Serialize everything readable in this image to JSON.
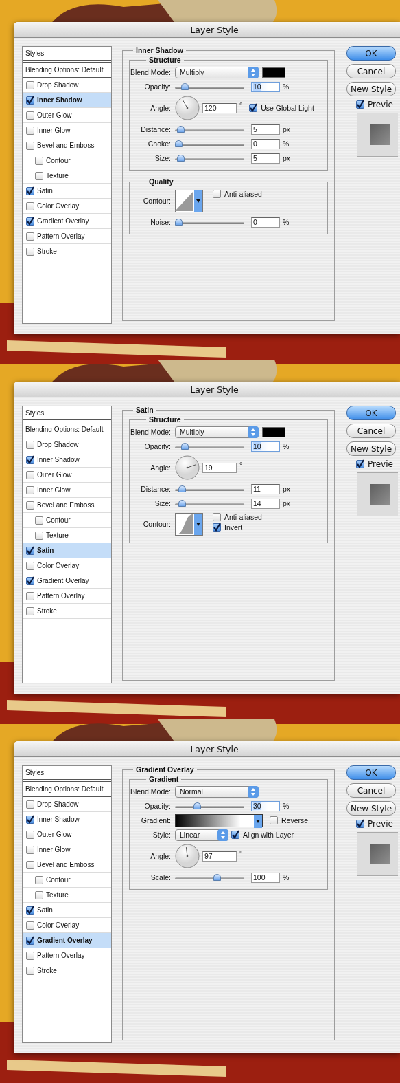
{
  "dialogs": [
    {
      "title": "Layer Style",
      "styles": {
        "header": "Styles",
        "blending": "Blending Options: Default",
        "items": [
          {
            "label": "Drop Shadow",
            "checked": false,
            "selected": false
          },
          {
            "label": "Inner Shadow",
            "checked": true,
            "selected": true
          },
          {
            "label": "Outer Glow",
            "checked": false,
            "selected": false
          },
          {
            "label": "Inner Glow",
            "checked": false,
            "selected": false
          },
          {
            "label": "Bevel and Emboss",
            "checked": false,
            "selected": false,
            "children": [
              {
                "label": "Contour",
                "checked": false,
                "selected": false
              },
              {
                "label": "Texture",
                "checked": false,
                "selected": false
              }
            ]
          },
          {
            "label": "Satin",
            "checked": true,
            "selected": false
          },
          {
            "label": "Color Overlay",
            "checked": false,
            "selected": false
          },
          {
            "label": "Gradient Overlay",
            "checked": true,
            "selected": false
          },
          {
            "label": "Pattern Overlay",
            "checked": false,
            "selected": false
          },
          {
            "label": "Stroke",
            "checked": false,
            "selected": false
          }
        ]
      },
      "section": {
        "title": "Inner Shadow",
        "groups": [
          {
            "title": "Structure",
            "rows": [
              {
                "kind": "select",
                "label": "Blend Mode:",
                "value": "Multiply",
                "swatch": true
              },
              {
                "kind": "slider",
                "label": "Opacity:",
                "level": 0.1,
                "value": "10",
                "unit": "%",
                "highlighted": true
              },
              {
                "kind": "angle",
                "label": "Angle:",
                "value": "120",
                "unit": "°",
                "checkbox": {
                  "label": "Use Global Light",
                  "checked": true
                }
              },
              {
                "kind": "slider",
                "label": "Distance:",
                "level": 0.03,
                "value": "5",
                "unit": "px",
                "highlighted": false
              },
              {
                "kind": "slider",
                "label": "Choke:",
                "level": 0,
                "value": "0",
                "unit": "%",
                "highlighted": false
              },
              {
                "kind": "slider",
                "label": "Size:",
                "level": 0.03,
                "value": "5",
                "unit": "px",
                "highlighted": false
              }
            ]
          },
          {
            "title": "Quality",
            "rows": [
              {
                "kind": "contour",
                "label": "Contour:",
                "curve": {
                  "kind": "linear"
                },
                "checkboxes": [
                  {
                    "label": "Anti-aliased",
                    "checked": false
                  }
                ]
              },
              {
                "kind": "slider",
                "label": "Noise:",
                "level": 0,
                "value": "0",
                "unit": "%",
                "highlighted": false
              }
            ]
          }
        ]
      },
      "buttons": [
        {
          "label": "OK",
          "default": true
        },
        {
          "label": "Cancel",
          "default": false
        },
        {
          "label": "New Style",
          "default": false
        }
      ],
      "preview": {
        "label": "Previe",
        "checked": true
      }
    },
    {
      "title": "Layer Style",
      "styles": {
        "header": "Styles",
        "blending": "Blending Options: Default",
        "items": [
          {
            "label": "Drop Shadow",
            "checked": false,
            "selected": false
          },
          {
            "label": "Inner Shadow",
            "checked": true,
            "selected": false
          },
          {
            "label": "Outer Glow",
            "checked": false,
            "selected": false
          },
          {
            "label": "Inner Glow",
            "checked": false,
            "selected": false
          },
          {
            "label": "Bevel and Emboss",
            "checked": false,
            "selected": false,
            "children": [
              {
                "label": "Contour",
                "checked": false,
                "selected": false
              },
              {
                "label": "Texture",
                "checked": false,
                "selected": false
              }
            ]
          },
          {
            "label": "Satin",
            "checked": true,
            "selected": true
          },
          {
            "label": "Color Overlay",
            "checked": false,
            "selected": false
          },
          {
            "label": "Gradient Overlay",
            "checked": true,
            "selected": false
          },
          {
            "label": "Pattern Overlay",
            "checked": false,
            "selected": false
          },
          {
            "label": "Stroke",
            "checked": false,
            "selected": false
          }
        ]
      },
      "section": {
        "title": "Satin",
        "groups": [
          {
            "title": "Structure",
            "rows": [
              {
                "kind": "select",
                "label": "Blend Mode:",
                "value": "Multiply",
                "swatch": true
              },
              {
                "kind": "slider",
                "label": "Opacity:",
                "level": 0.1,
                "value": "10",
                "unit": "%",
                "highlighted": true
              },
              {
                "kind": "angle",
                "label": "Angle:",
                "value": "19",
                "unit": "°"
              },
              {
                "kind": "slider",
                "label": "Distance:",
                "level": 0.05,
                "value": "11",
                "unit": "px",
                "highlighted": false
              },
              {
                "kind": "slider",
                "label": "Size:",
                "level": 0.06,
                "value": "14",
                "unit": "px",
                "highlighted": false
              },
              {
                "kind": "contour",
                "label": "Contour:",
                "curve": {
                  "kind": "s-curve"
                },
                "checkboxes": [
                  {
                    "label": "Anti-aliased",
                    "checked": false
                  },
                  {
                    "label": "Invert",
                    "checked": true
                  }
                ]
              }
            ]
          }
        ]
      },
      "buttons": [
        {
          "label": "OK",
          "default": true
        },
        {
          "label": "Cancel",
          "default": false
        },
        {
          "label": "New Style",
          "default": false
        }
      ],
      "preview": {
        "label": "Previe",
        "checked": true
      }
    },
    {
      "title": "Layer Style",
      "styles": {
        "header": "Styles",
        "blending": "Blending Options: Default",
        "items": [
          {
            "label": "Drop Shadow",
            "checked": false,
            "selected": false
          },
          {
            "label": "Inner Shadow",
            "checked": true,
            "selected": false
          },
          {
            "label": "Outer Glow",
            "checked": false,
            "selected": false
          },
          {
            "label": "Inner Glow",
            "checked": false,
            "selected": false
          },
          {
            "label": "Bevel and Emboss",
            "checked": false,
            "selected": false,
            "children": [
              {
                "label": "Contour",
                "checked": false,
                "selected": false
              },
              {
                "label": "Texture",
                "checked": false,
                "selected": false
              }
            ]
          },
          {
            "label": "Satin",
            "checked": true,
            "selected": false
          },
          {
            "label": "Color Overlay",
            "checked": false,
            "selected": false
          },
          {
            "label": "Gradient Overlay",
            "checked": true,
            "selected": true
          },
          {
            "label": "Pattern Overlay",
            "checked": false,
            "selected": false
          },
          {
            "label": "Stroke",
            "checked": false,
            "selected": false
          }
        ]
      },
      "section": {
        "title": "Gradient Overlay",
        "groups": [
          {
            "title": "Gradient",
            "rows": [
              {
                "kind": "select",
                "label": "Blend Mode:",
                "value": "Normal",
                "swatch": false
              },
              {
                "kind": "slider",
                "label": "Opacity:",
                "level": 0.3,
                "value": "30",
                "unit": "%",
                "highlighted": true
              },
              {
                "kind": "gradient",
                "label": "Gradient:",
                "checkbox": {
                  "label": "Reverse",
                  "checked": false
                }
              },
              {
                "kind": "select",
                "label": "Style:",
                "value": "Linear",
                "swatch": false,
                "checkbox": {
                  "label": "Align with Layer",
                  "checked": true
                }
              },
              {
                "kind": "angle",
                "label": "Angle:",
                "value": "97",
                "unit": "°"
              },
              {
                "kind": "slider",
                "label": "Scale:",
                "level": 0.62,
                "value": "100",
                "unit": "%",
                "highlighted": false
              }
            ]
          }
        ]
      },
      "buttons": [
        {
          "label": "OK",
          "default": true
        },
        {
          "label": "Cancel",
          "default": false
        },
        {
          "label": "New Style",
          "default": false
        }
      ],
      "preview": {
        "label": "Previe",
        "checked": true
      }
    }
  ]
}
